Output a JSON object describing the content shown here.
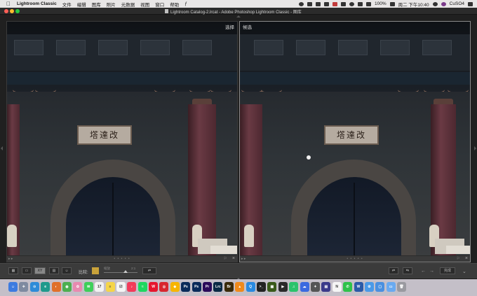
{
  "menubar": {
    "app_name": "Lightroom Classic",
    "items": [
      "文件",
      "编辑",
      "图库",
      "照片",
      "元数据",
      "视图",
      "窗口",
      "帮助"
    ],
    "battery": "100%",
    "datetime": "周二 下午10:40",
    "user": "CuSO4"
  },
  "window": {
    "title": "Lightroom Catalog-2.lrcat - Adobe Photoshop Lightroom Classic - 图库"
  },
  "panes": {
    "left": {
      "label": "选择",
      "plaque_text": "㙮達改"
    },
    "right": {
      "label": "候选",
      "plaque_text": "㙮達改"
    }
  },
  "toolbar": {
    "compare_label": "比较:",
    "zoom_label": "缩放",
    "zoom_value": "2:1",
    "done_label": "完成",
    "icons": [
      "grid-view-icon",
      "loupe-view-icon",
      "compare-view-icon",
      "survey-view-icon",
      "people-view-icon",
      "lock-icon",
      "sync-icon",
      "swap-icon",
      "prev-arrow-icon",
      "next-arrow-icon"
    ]
  },
  "dock": {
    "apps": [
      {
        "name": "finder",
        "color": "#3d7be0",
        "glyph": "☺"
      },
      {
        "name": "launchpad",
        "color": "#7e8aa0",
        "glyph": "✈"
      },
      {
        "name": "safari",
        "color": "#2e8bd8",
        "glyph": "⊙"
      },
      {
        "name": "edge",
        "color": "#1f9a8c",
        "glyph": "e"
      },
      {
        "name": "firefox",
        "color": "#e0702a",
        "glyph": "◐"
      },
      {
        "name": "chrome",
        "color": "#4caf50",
        "glyph": "◉"
      },
      {
        "name": "photos",
        "color": "#e88ab0",
        "glyph": "✿"
      },
      {
        "name": "messages",
        "color": "#3ecf5a",
        "glyph": "✉"
      },
      {
        "name": "calendar",
        "color": "#f2f2f2",
        "glyph": "17"
      },
      {
        "name": "notes",
        "color": "#f5d547",
        "glyph": "≡"
      },
      {
        "name": "reminders",
        "color": "#f5f5f5",
        "glyph": "☑"
      },
      {
        "name": "music",
        "color": "#f23b5a",
        "glyph": "♪"
      },
      {
        "name": "spotify",
        "color": "#1ed760",
        "glyph": "≈"
      },
      {
        "name": "weibo",
        "color": "#e6162d",
        "glyph": "W"
      },
      {
        "name": "netease",
        "color": "#d8262e",
        "glyph": "◎"
      },
      {
        "name": "sketch",
        "color": "#f7b500",
        "glyph": "◆"
      },
      {
        "name": "photoshop",
        "color": "#0a2a5a",
        "glyph": "Ps"
      },
      {
        "name": "photoshop2",
        "color": "#0a2a5a",
        "glyph": "Ps"
      },
      {
        "name": "premiere",
        "color": "#2a0a5a",
        "glyph": "Pr"
      },
      {
        "name": "lightroom",
        "color": "#0a2a45",
        "glyph": "Lrc"
      },
      {
        "name": "bridge",
        "color": "#3a2a0a",
        "glyph": "Br"
      },
      {
        "name": "vlc",
        "color": "#f08a1c",
        "glyph": "▲"
      },
      {
        "name": "qq",
        "color": "#2a8ae0",
        "glyph": "Q"
      },
      {
        "name": "terminal",
        "color": "#222222",
        "glyph": ">_"
      },
      {
        "name": "gpu",
        "color": "#3a5a1a",
        "glyph": "▦"
      },
      {
        "name": "infuse",
        "color": "#2a2a2a",
        "glyph": "▶"
      },
      {
        "name": "qq-music",
        "color": "#2bc36b",
        "glyph": "♫"
      },
      {
        "name": "cloud",
        "color": "#3a6ae0",
        "glyph": "☁"
      },
      {
        "name": "davinci",
        "color": "#555555",
        "glyph": "✦"
      },
      {
        "name": "pixel",
        "color": "#3a3a8a",
        "glyph": "▤"
      },
      {
        "name": "notion",
        "color": "#f5f5f5",
        "glyph": "N"
      },
      {
        "name": "wechat",
        "color": "#2ec24a",
        "glyph": "✆"
      },
      {
        "name": "word",
        "color": "#2a5aa8",
        "glyph": "W"
      },
      {
        "name": "network",
        "color": "#4a9ae8",
        "glyph": "⚙"
      },
      {
        "name": "downloads",
        "color": "#4a90e0",
        "glyph": "▢"
      },
      {
        "name": "folder",
        "color": "#6aaaf0",
        "glyph": "▭"
      },
      {
        "name": "trash",
        "color": "#9a9aa0",
        "glyph": "🗑"
      }
    ]
  }
}
